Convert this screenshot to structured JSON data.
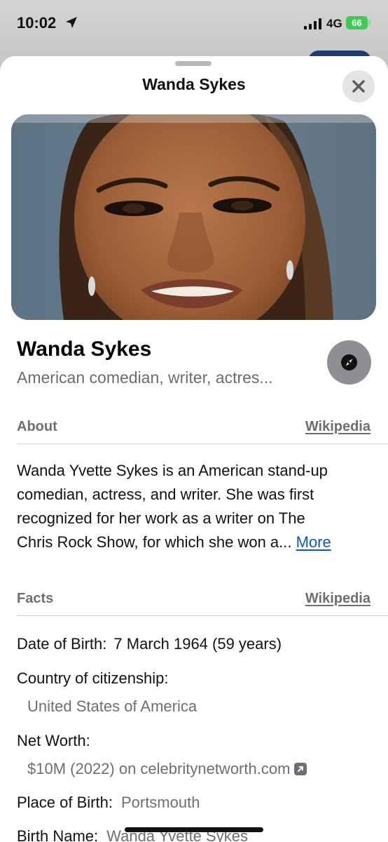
{
  "status_bar": {
    "time": "10:02",
    "network": "4G",
    "battery": "66"
  },
  "sheet": {
    "title": "Wanda Sykes"
  },
  "header": {
    "name": "Wanda Sykes",
    "description": "American comedian, writer, actres..."
  },
  "about": {
    "label": "About",
    "source": "Wikipedia",
    "lines": [
      "Wanda Yvette Sykes is an American stand-up",
      "comedian, actress, and writer. She was first",
      "recognized for her work as a writer on The",
      "Chris Rock Show, for which she won a..."
    ],
    "more": "More"
  },
  "facts": {
    "label": "Facts",
    "source": "Wikipedia",
    "date_of_birth": {
      "label": "Date of Birth:",
      "value": "7 March 1964 (59 years)"
    },
    "citizenship": {
      "label": "Country of citizenship:",
      "value": "United States of America"
    },
    "net_worth": {
      "label": "Net Worth:",
      "value": "$10M (2022) on celebritynetworth.com"
    },
    "place_of_birth": {
      "label": "Place of Birth:",
      "value": "Portsmouth"
    },
    "birth_name": {
      "label": "Birth Name:",
      "value": "Wanda Yvette Sykes"
    }
  },
  "colors": {
    "link": "#1256c4",
    "battery": "#43c95a",
    "secondary_text": "#6e6e73"
  }
}
